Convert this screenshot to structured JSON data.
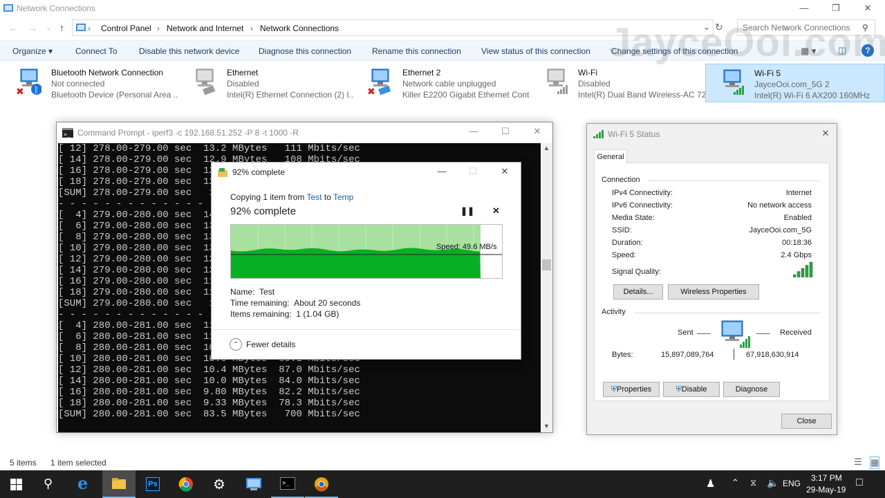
{
  "explorer": {
    "title": "Network Connections",
    "breadcrumb": [
      "Control Panel",
      "Network and Internet",
      "Network Connections"
    ],
    "search_placeholder": "Search Network Connections",
    "commands": [
      "Organize",
      "Connect To",
      "Disable this network device",
      "Diagnose this connection",
      "Rename this connection",
      "View status of this connection",
      "Change settings of this connection"
    ],
    "connections": [
      {
        "name": "Bluetooth Network Connection",
        "status": "Not connected",
        "device": "Bluetooth Device (Personal Area ..."
      },
      {
        "name": "Ethernet",
        "status": "Disabled",
        "device": "Intel(R) Ethernet Connection (2) I..."
      },
      {
        "name": "Ethernet 2",
        "status": "Network cable unplugged",
        "device": "Killer E2200 Gigabit Ethernet Cont..."
      },
      {
        "name": "Wi-Fi",
        "status": "Disabled",
        "device": "Intel(R) Dual Band Wireless-AC 72..."
      },
      {
        "name": "Wi-Fi 5",
        "status": "JayceOoi.com_5G 2",
        "device": "Intel(R) Wi-Fi 6 AX200 160MHz"
      }
    ],
    "status_items": "5 items",
    "status_selected": "1 item selected",
    "watermark": "JayceOoi.com"
  },
  "cmd": {
    "title": "Command Prompt - iperf3  -c 192.168.51.252 -P 8 -t 1000 -R",
    "lines": [
      "[ 12] 278.00-279.00 sec  13.2 MBytes   111 Mbits/sec",
      "[ 14] 278.00-279.00 sec  12.9 MBytes   108 Mbits/sec",
      "[ 16] 278.00-279.00 sec  12.",
      "[ 18] 278.00-279.00 sec  12.",
      "[SUM] 278.00-279.00 sec   10",
      "- - - - - - - - - - - - - -",
      "[  4] 279.00-280.00 sec  14.",
      "[  6] 279.00-280.00 sec  13.",
      "[  8] 279.00-280.00 sec  13.",
      "[ 10] 279.00-280.00 sec  13.",
      "[ 12] 279.00-280.00 sec  12.",
      "[ 14] 279.00-280.00 sec  12.",
      "[ 16] 279.00-280.00 sec  11.",
      "[ 18] 279.00-280.00 sec  11.",
      "[SUM] 279.00-280.00 sec   10",
      "- - - - - - - - - - - - - -",
      "[  4] 280.00-281.00 sec  11.",
      "[  6] 280.00-281.00 sec  11.",
      "[  8] 280.00-281.00 sec  10.",
      "[ 10] 280.00-281.00 sec  10.6 MBytes  89.1 Mbits/sec",
      "[ 12] 280.00-281.00 sec  10.4 MBytes  87.0 Mbits/sec",
      "[ 14] 280.00-281.00 sec  10.0 MBytes  84.0 Mbits/sec",
      "[ 16] 280.00-281.00 sec  9.80 MBytes  82.2 Mbits/sec",
      "[ 18] 280.00-281.00 sec  9.33 MBytes  78.3 Mbits/sec",
      "[SUM] 280.00-281.00 sec  83.5 MBytes   700 Mbits/sec"
    ]
  },
  "copy": {
    "title": "92% complete",
    "copying_prefix": "Copying 1 item from",
    "from": "Test",
    "to_word": "to",
    "to": "Temp",
    "heading": "92% complete",
    "progress": 0.92,
    "speed": "Speed: 49.6 MB/s",
    "name_label": "Name:",
    "name_value": "Test",
    "time_label": "Time remaining:",
    "time_value": "About 20 seconds",
    "items_label": "Items remaining:",
    "items_value": "1 (1.04 GB)",
    "fewer_details": "Fewer details"
  },
  "wifi": {
    "title": "Wi-Fi 5 Status",
    "tab": "General",
    "connection_header": "Connection",
    "rows": [
      {
        "label": "IPv4 Connectivity:",
        "value": "Internet"
      },
      {
        "label": "IPv6 Connectivity:",
        "value": "No network access"
      },
      {
        "label": "Media State:",
        "value": "Enabled"
      },
      {
        "label": "SSID:",
        "value": "JayceOoi.com_5G"
      },
      {
        "label": "Duration:",
        "value": "00:18:36"
      },
      {
        "label": "Speed:",
        "value": "2.4 Gbps"
      }
    ],
    "signal_label": "Signal Quality:",
    "signal_bars": 5,
    "details_btn": "Details...",
    "wireless_btn": "Wireless Properties",
    "activity_header": "Activity",
    "sent_label": "Sent",
    "received_label": "Received",
    "bytes_label": "Bytes:",
    "bytes_sent": "15,897,089,764",
    "bytes_received": "67,918,630,914",
    "properties_btn": "Properties",
    "disable_btn": "Disable",
    "diagnose_btn": "Diagnose",
    "close_btn": "Close"
  },
  "taskbar": {
    "lang": "ENG",
    "time": "3:17 PM",
    "date": "29-May-19"
  },
  "colors": {
    "progress_fill": "#06b025",
    "progress_bg": "#a8e0a0",
    "accent": "#0078d7"
  }
}
